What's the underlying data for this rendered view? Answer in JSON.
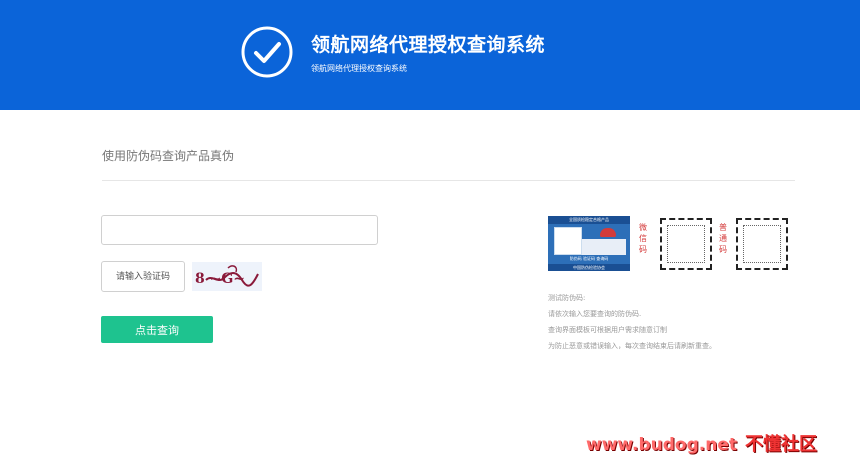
{
  "header": {
    "title": "领航网络代理授权查询系统",
    "subtitle": "领航网络代理授权查询系统",
    "bg_color": "#0b64d9"
  },
  "main": {
    "section_title": "使用防伪码查询产品真伪",
    "code_input": {
      "value": "",
      "placeholder": ""
    },
    "captcha_input": {
      "value": "",
      "placeholder": "请输入验证码"
    },
    "captcha_text": "8 ~G~",
    "query_button_label": "点击查询",
    "button_color": "#1ec38f"
  },
  "sample": {
    "label_top": "全国质检稳定合格产品",
    "label_mid": "防伪码  验证码  查询码",
    "label_bottom": "中国防伪检验协会",
    "wechat_code_label": "微信码",
    "normal_code_label": "普通码"
  },
  "notes": {
    "heading": "测试防伪码:",
    "lines": [
      "请依次输入您要查询的防伪码.",
      "查询界面模板可根据用户需求随意订制",
      "为防止恶意或错误输入，每次查询结束后请刷新重查。"
    ]
  },
  "watermark": {
    "domain": "www.budog.net",
    "brand": "不懂社区"
  }
}
